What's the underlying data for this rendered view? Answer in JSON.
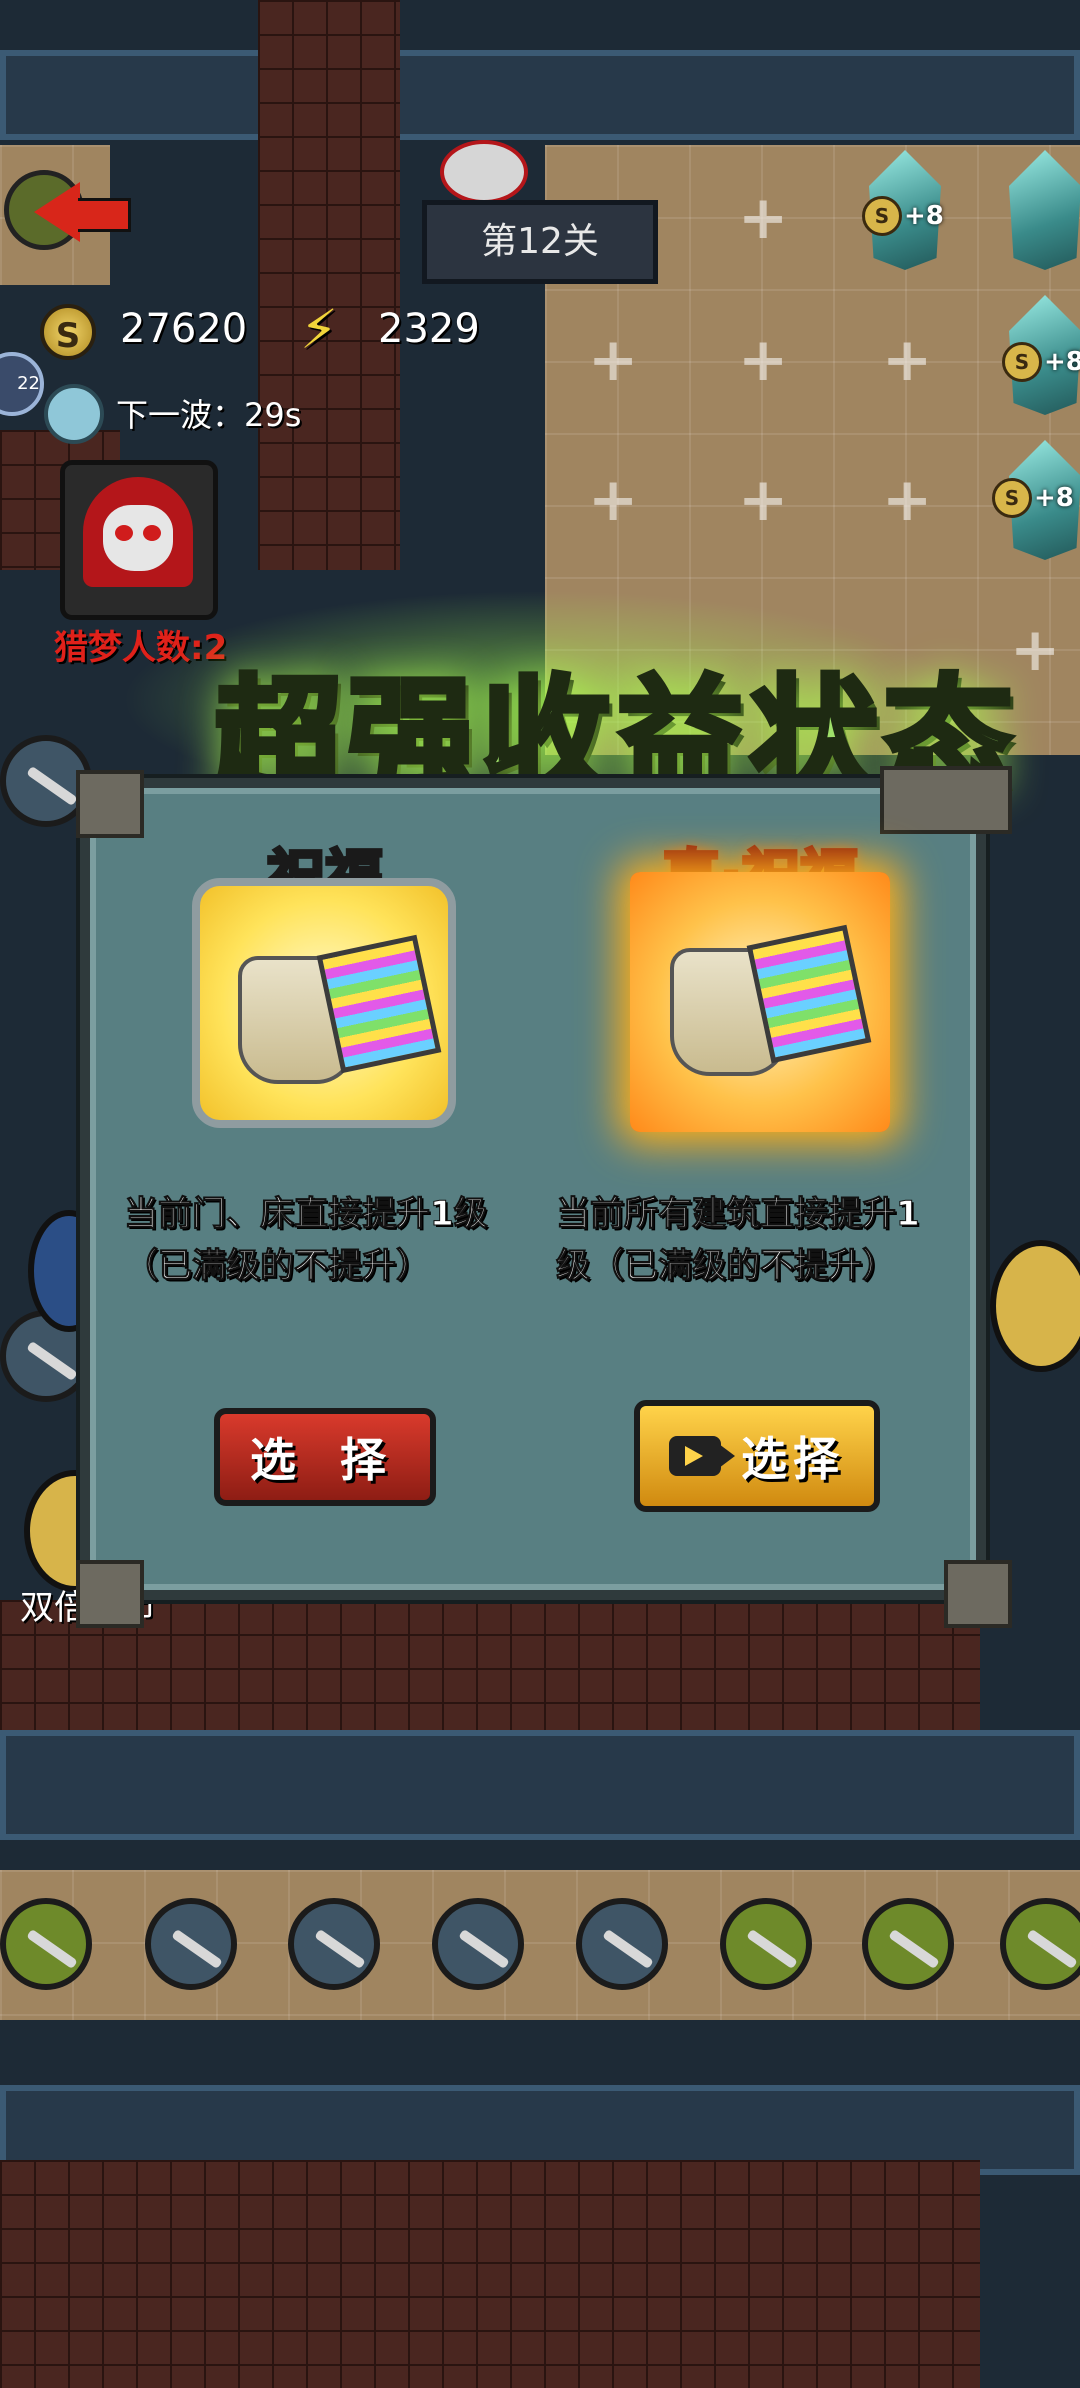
{
  "hud": {
    "level": "第12关",
    "coins": "27620",
    "energy": "2329",
    "next_wave": "下一波：29s",
    "hunter_count": "猎梦人数:2",
    "bonus_plus": "+8",
    "badge_num": "22",
    "bottom_left_label": "双倍金币"
  },
  "modal": {
    "title": "超强收益状态",
    "options": [
      {
        "label": "祝福",
        "description": "当前门、床直接提升1级（已满级的不提升）",
        "description_line1": "当前门、床直接提升1级",
        "description_line2": "（已满级的不提升）",
        "button": "选 择",
        "button_color": "#c62a20"
      },
      {
        "label": "真·祝福",
        "description_line1": "当前所有建筑直接提升1",
        "description_line2": "级（已满级的不提升）",
        "button": "选择",
        "button_color": "#f0b52a",
        "button_icon": "video-camera-icon"
      }
    ]
  },
  "colors": {
    "title_green": "#9fe06a",
    "modal_bg": "#587f82",
    "floor": "#a08560",
    "brick": "#4a2620"
  }
}
